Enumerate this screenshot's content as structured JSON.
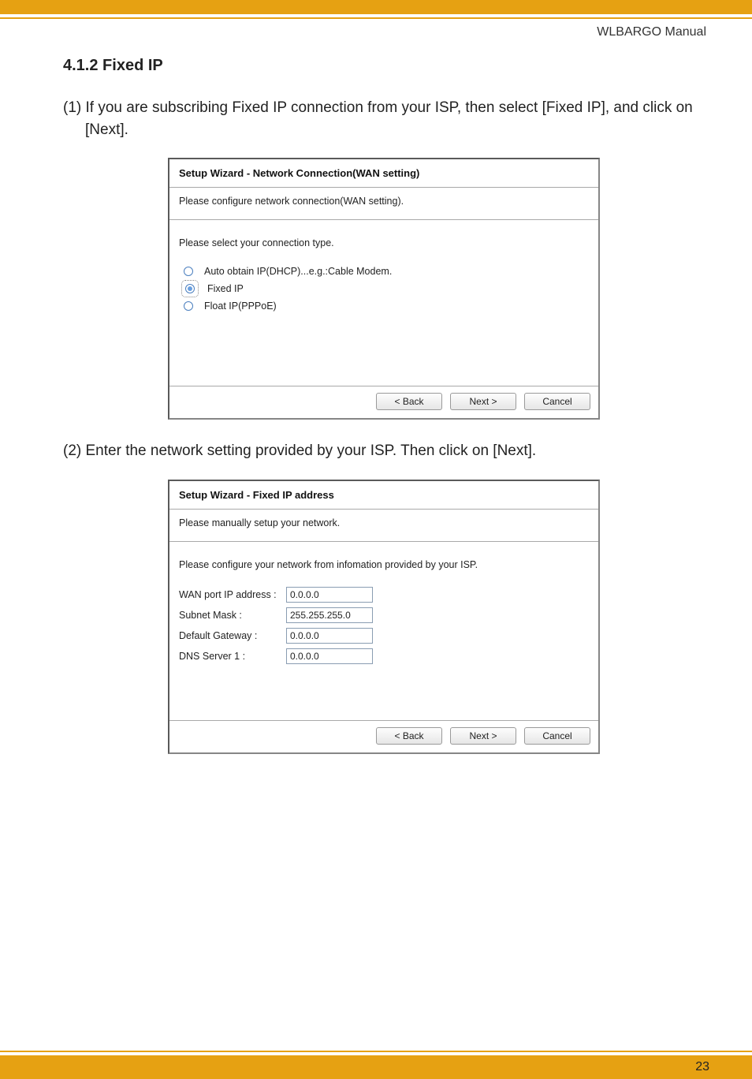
{
  "header": {
    "manual": "WLBARGO Manual"
  },
  "section": {
    "number": "4.1.2",
    "title": "Fixed IP"
  },
  "steps": {
    "s1": "(1) If you are subscribing Fixed IP connection from your ISP, then select [Fixed IP], and click on [Next].",
    "s2": "(2) Enter the network setting provided by your ISP. Then click on [Next]."
  },
  "wizard1": {
    "title": "Setup Wizard - Network Connection(WAN setting)",
    "subtitle": "Please configure network connection(WAN setting).",
    "prompt": "Please select your connection type.",
    "options": {
      "o1": "Auto obtain IP(DHCP)...e.g.:Cable Modem.",
      "o2": "Fixed IP",
      "o3": "Float IP(PPPoE)"
    },
    "selected": "o2",
    "buttons": {
      "back": "< Back",
      "next": "Next >",
      "cancel": "Cancel"
    }
  },
  "wizard2": {
    "title": "Setup Wizard - Fixed IP address",
    "subtitle": "Please manually setup your network.",
    "prompt": "Please configure your network from infomation provided by your ISP.",
    "fields": {
      "wan_ip": {
        "label": "WAN port IP address :",
        "value": "0.0.0.0"
      },
      "subnet": {
        "label": "Subnet Mask :",
        "value": "255.255.255.0"
      },
      "gateway": {
        "label": "Default Gateway :",
        "value": "0.0.0.0"
      },
      "dns1": {
        "label": "DNS Server 1 :",
        "value": "0.0.0.0"
      }
    },
    "buttons": {
      "back": "< Back",
      "next": "Next >",
      "cancel": "Cancel"
    }
  },
  "footer": {
    "page": "23"
  }
}
